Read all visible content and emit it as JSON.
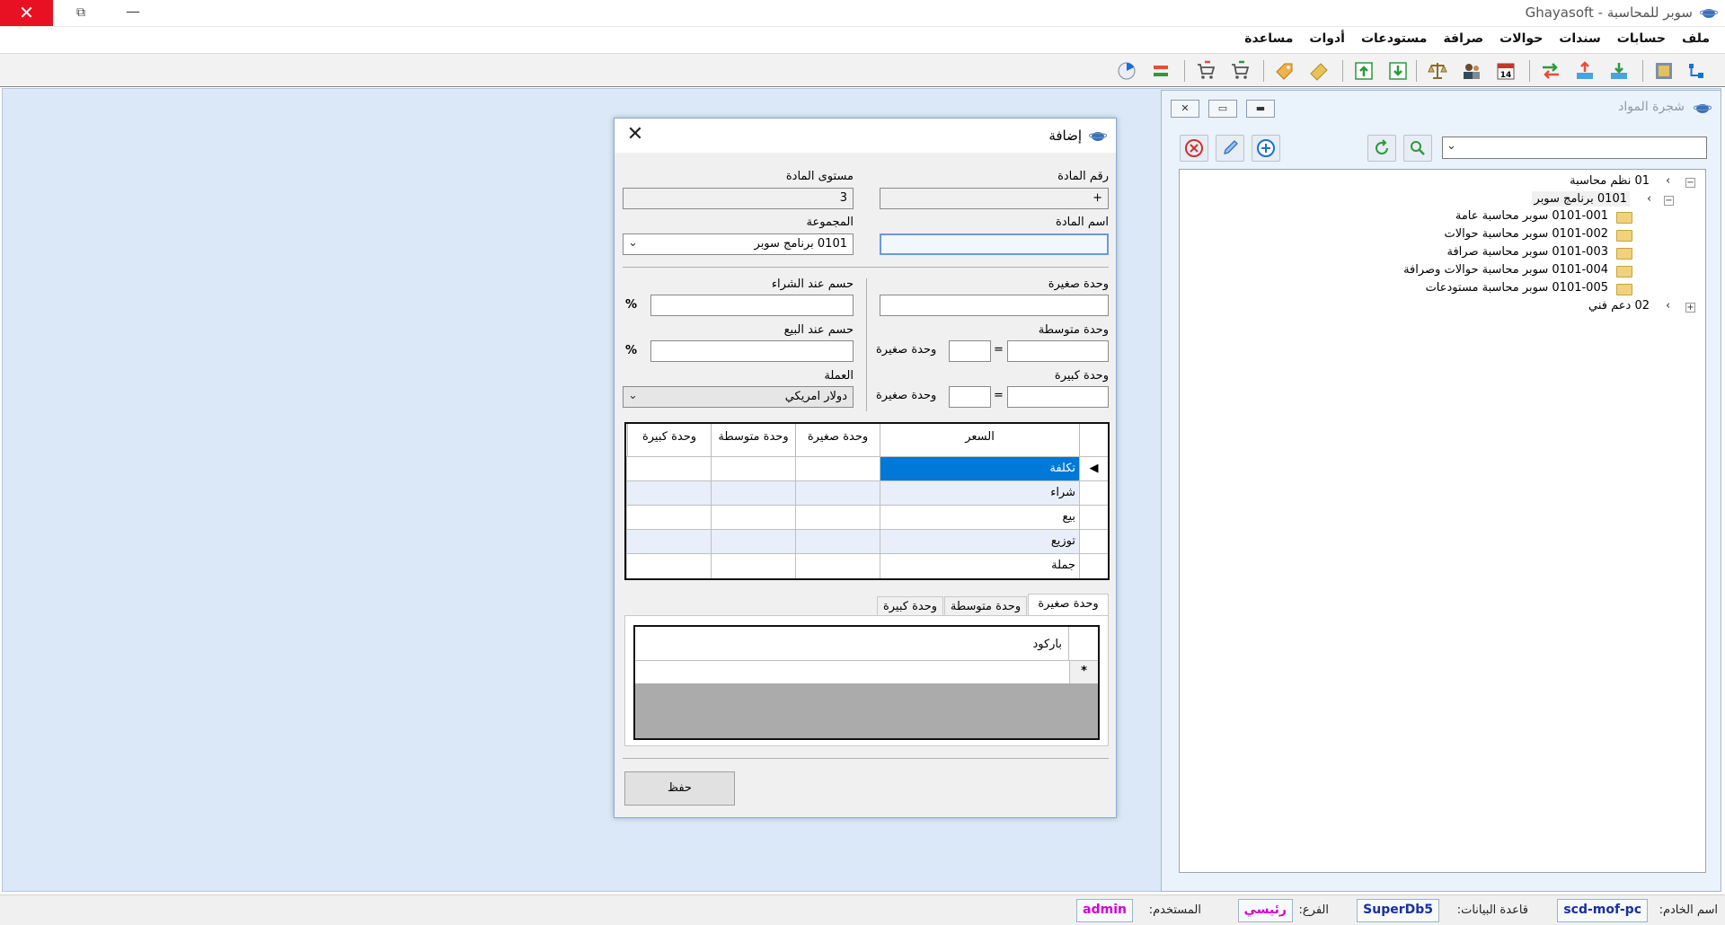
{
  "window": {
    "title": "سوبر للمحاسبة - Ghayasoft"
  },
  "menu": [
    "ملف",
    "حسابات",
    "سندات",
    "حوالات",
    "صرافة",
    "مستودعات",
    "أدوات",
    "مساعدة"
  ],
  "tree_panel": {
    "title": "شجرة المواد",
    "search_value": "",
    "nodes": [
      {
        "label": "01 نظم محاسبة"
      },
      {
        "label": "0101 برنامج سوبر"
      },
      {
        "label": "0101-001 سوبر محاسبة عامة"
      },
      {
        "label": "0101-002 سوبر محاسبة حوالات"
      },
      {
        "label": "0101-003 سوبر محاسبة صرافة"
      },
      {
        "label": "0101-004 سوبر محاسبة حوالات وصرافة"
      },
      {
        "label": "0101-005 سوبر محاسبة مستودعات"
      },
      {
        "label": "02 دعم فني"
      }
    ]
  },
  "dialog": {
    "title": "إضافة",
    "item_number_label": "رقم المادة",
    "item_number_value": "+",
    "item_level_label": "مستوى المادة",
    "item_level_value": "3",
    "item_name_label": "اسم المادة",
    "item_name_value": "",
    "group_label": "المجموعة",
    "group_value": "0101 برنامج سوبر",
    "small_unit_label": "وحدة صغيرة",
    "medium_unit_label": "وحدة متوسطة",
    "large_unit_label": "وحدة كبيرة",
    "equals": "=",
    "small_unit_suffix": "وحدة صغيرة",
    "purchase_discount_label": "حسم عند الشراء",
    "sale_discount_label": "حسم عند البيع",
    "percent": "%",
    "currency_label": "العملة",
    "currency_value": "دولار امريكي",
    "price_grid": {
      "headers": [
        "السعر",
        "وحدة صغيرة",
        "وحدة متوسطة",
        "وحدة كبيرة"
      ],
      "rows": [
        "تكلفة",
        "شراء",
        "بيع",
        "توزيع",
        "جملة"
      ]
    },
    "tabs": [
      "وحدة صغيرة",
      "وحدة متوسطة",
      "وحدة كبيرة"
    ],
    "barcode_header": "باركود",
    "new_row_marker": "*",
    "save_label": "حفظ"
  },
  "status": {
    "server_label": "اسم الخادم:",
    "server_value": "scd-mof-pc",
    "db_label": "قاعدة البيانات:",
    "db_value": "SuperDb5",
    "branch_label": "الفرع:",
    "branch_value": "رئيسي",
    "user_label": "المستخدم:",
    "user_value": "admin"
  },
  "colors": {
    "accent_selection": "#0078d7",
    "close_red": "#e81123",
    "status_blue": "#1a2fa0",
    "status_magenta": "#d400d4"
  }
}
